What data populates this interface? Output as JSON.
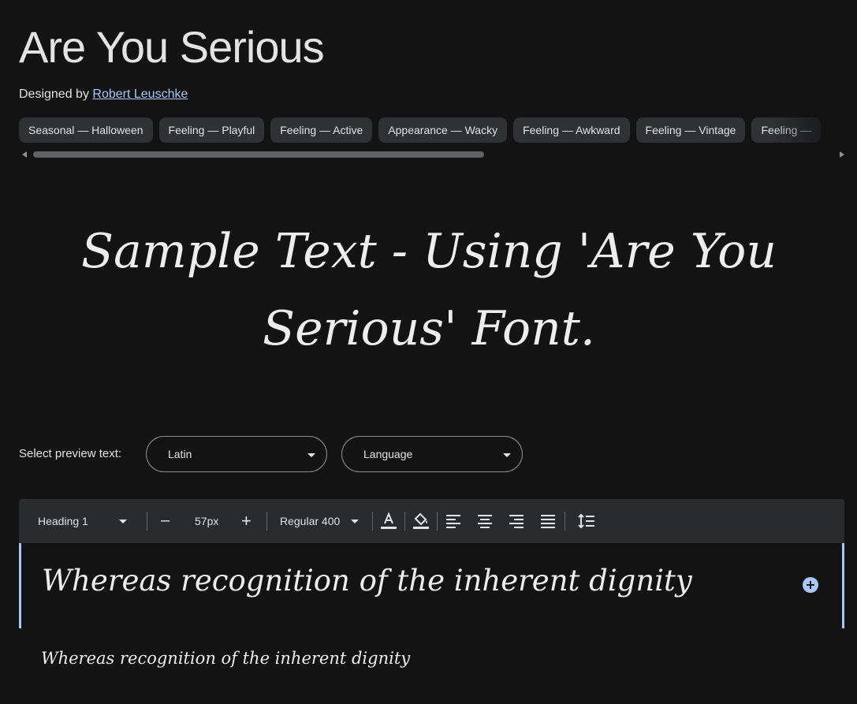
{
  "font": {
    "title": "Are You Serious",
    "designed_by_label": "Designed by",
    "designer_name": "Robert Leuschke"
  },
  "tags": [
    "Seasonal — Halloween",
    "Feeling — Playful",
    "Feeling — Active",
    "Appearance — Wacky",
    "Feeling — Awkward",
    "Feeling — Vintage",
    "Feeling — "
  ],
  "sample": {
    "text": "Sample Text - Using 'Are You Serious' Font."
  },
  "preview": {
    "label": "Select preview text:",
    "script_select": "Latin",
    "language_select": "Language"
  },
  "toolbar": {
    "style_select": "Heading 1",
    "size_decrease": "–",
    "size_value": "57px",
    "size_increase": "+",
    "weight_select": "Regular 400"
  },
  "editor": {
    "row1_text": "Whereas recognition of the inherent dignity",
    "row2_text": "Whereas recognition of the inherent dignity"
  },
  "colors": {
    "background": "#131314",
    "accent": "#a8c7fa",
    "chip": "#303134",
    "toolbar": "#2a2b2d"
  }
}
